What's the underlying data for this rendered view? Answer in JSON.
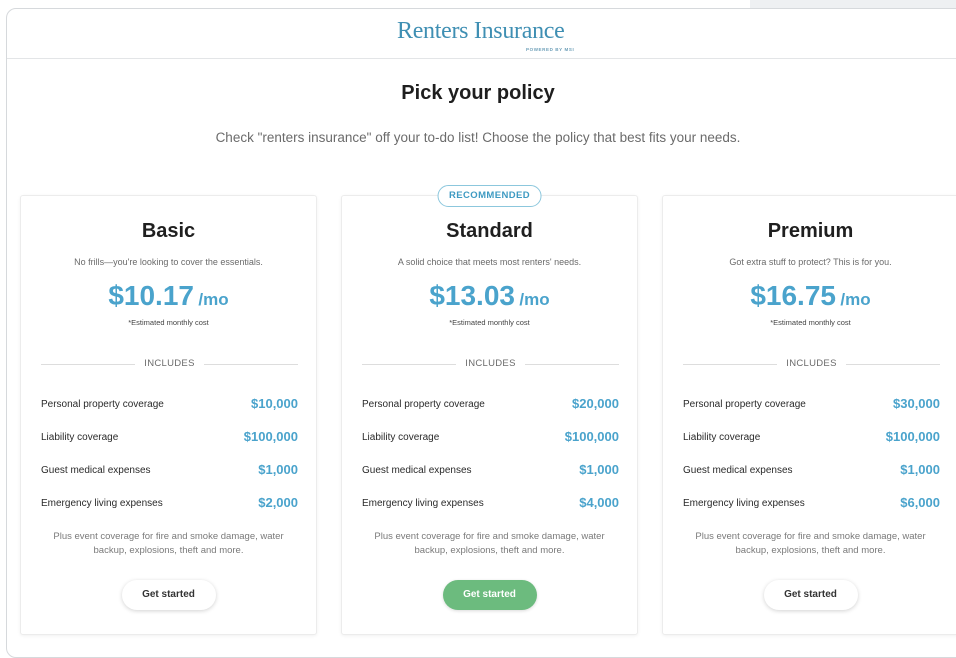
{
  "header": {
    "logo": "Renters Insurance",
    "logo_sub": "POWERED BY MSI"
  },
  "main": {
    "title": "Pick your policy",
    "subtitle": "Check \"renters insurance\" off your to-do list! Choose the policy that best fits your needs."
  },
  "plans": [
    {
      "name": "Basic",
      "desc": "No frills—you're looking to cover the essentials.",
      "price": "$10.17",
      "per": "/mo",
      "est": "*Estimated monthly cost",
      "includes": "INCLUDES",
      "rows": [
        {
          "name": "Personal property coverage",
          "value": "$10,000"
        },
        {
          "name": "Liability coverage",
          "value": "$100,000"
        },
        {
          "name": "Guest medical expenses",
          "value": "$1,000"
        },
        {
          "name": "Emergency living expenses",
          "value": "$2,000"
        }
      ],
      "plus": "Plus event coverage for fire and smoke damage, water backup, explosions, theft and more.",
      "button": "Get started"
    },
    {
      "badge": "RECOMMENDED",
      "name": "Standard",
      "desc": "A solid choice that meets most renters' needs.",
      "price": "$13.03",
      "per": "/mo",
      "est": "*Estimated monthly cost",
      "includes": "INCLUDES",
      "rows": [
        {
          "name": "Personal property coverage",
          "value": "$20,000"
        },
        {
          "name": "Liability coverage",
          "value": "$100,000"
        },
        {
          "name": "Guest medical expenses",
          "value": "$1,000"
        },
        {
          "name": "Emergency living expenses",
          "value": "$4,000"
        }
      ],
      "plus": "Plus event coverage for fire and smoke damage, water backup, explosions, theft and more.",
      "button": "Get started"
    },
    {
      "name": "Premium",
      "desc": "Got extra stuff to protect? This is for you.",
      "price": "$16.75",
      "per": "/mo",
      "est": "*Estimated monthly cost",
      "includes": "INCLUDES",
      "rows": [
        {
          "name": "Personal property coverage",
          "value": "$30,000"
        },
        {
          "name": "Liability coverage",
          "value": "$100,000"
        },
        {
          "name": "Guest medical expenses",
          "value": "$1,000"
        },
        {
          "name": "Emergency living expenses",
          "value": "$6,000"
        }
      ],
      "plus": "Plus event coverage for fire and smoke damage, water backup, explosions, theft and more.",
      "button": "Get started"
    }
  ],
  "colors": {
    "accent": "#4aa3cc",
    "primary_button": "#6cbb7e",
    "logo": "#3f8fb3"
  }
}
